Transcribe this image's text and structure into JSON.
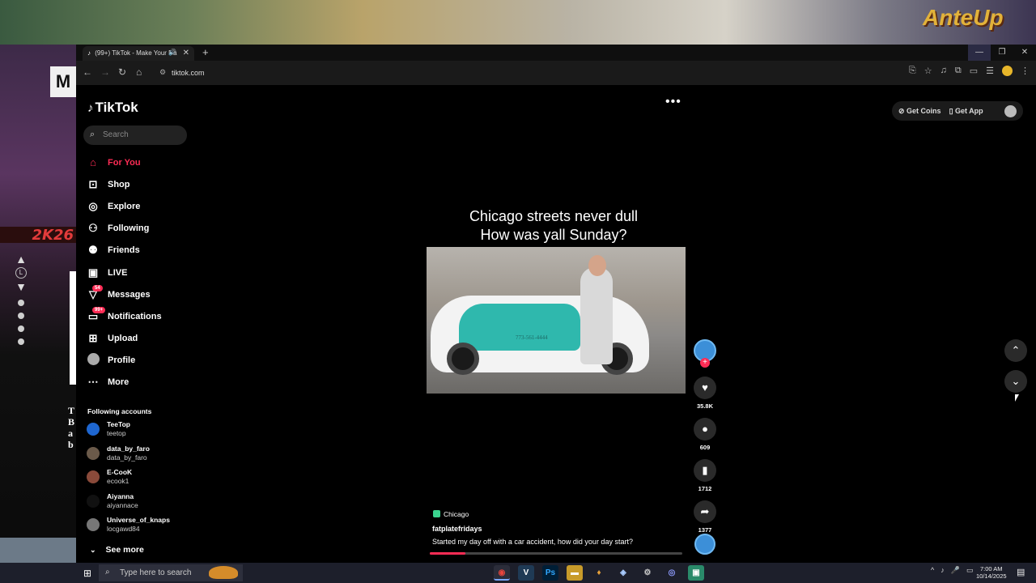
{
  "background": {
    "logo_2k": "2K26",
    "logo_m": "M",
    "anteup_text": "AnteUp",
    "side_letters": "T B a b",
    "nav_letter": "L"
  },
  "browser": {
    "tab_title": "(99+) TikTok - Make Your Da",
    "url": "tiktok.com"
  },
  "tiktok": {
    "logo": "TikTok",
    "search_placeholder": "Search",
    "nav": [
      {
        "label": "For You",
        "icon": "home-icon",
        "active": true
      },
      {
        "label": "Shop",
        "icon": "shop-icon"
      },
      {
        "label": "Explore",
        "icon": "compass-icon"
      },
      {
        "label": "Following",
        "icon": "following-icon"
      },
      {
        "label": "Friends",
        "icon": "friends-icon"
      },
      {
        "label": "LIVE",
        "icon": "live-icon"
      },
      {
        "label": "Messages",
        "icon": "messages-icon",
        "badge": "54"
      },
      {
        "label": "Notifications",
        "icon": "notifications-icon",
        "badge": "99+"
      },
      {
        "label": "Upload",
        "icon": "upload-icon"
      },
      {
        "label": "Profile",
        "icon": "profile-icon"
      },
      {
        "label": "More",
        "icon": "more-icon"
      }
    ],
    "following_heading": "Following accounts",
    "accounts": [
      {
        "name": "TeeTop",
        "handle": "teetop",
        "color": "#1e66d0"
      },
      {
        "name": "data_by_faro",
        "handle": "data_by_faro",
        "color": "#6b5a4a"
      },
      {
        "name": "E-CooK",
        "handle": "ecook1",
        "color": "#8a4a3a"
      },
      {
        "name": "Aiyanna",
        "handle": "aiyannace",
        "color": "#111111"
      },
      {
        "name": "Universe_of_knaps",
        "handle": "locgawd84",
        "color": "#777777"
      }
    ],
    "see_more": "See more",
    "get_coins": "Get Coins",
    "get_app": "Get App",
    "video": {
      "caption_line1": "Chicago streets never dull",
      "caption_line2": "How was yall Sunday?",
      "taxi_number": "773-561-4444",
      "likes": "35.8K",
      "comments": "609",
      "saves": "1712",
      "shares": "1377",
      "location": "Chicago",
      "author": "fatplatefridays",
      "description": "Started my day off with a car accident, how did your day start?",
      "progress": 0.14
    }
  },
  "taskbar": {
    "search_placeholder": "Type here to search",
    "time": "7:00 AM",
    "date": "10/14/2025"
  }
}
